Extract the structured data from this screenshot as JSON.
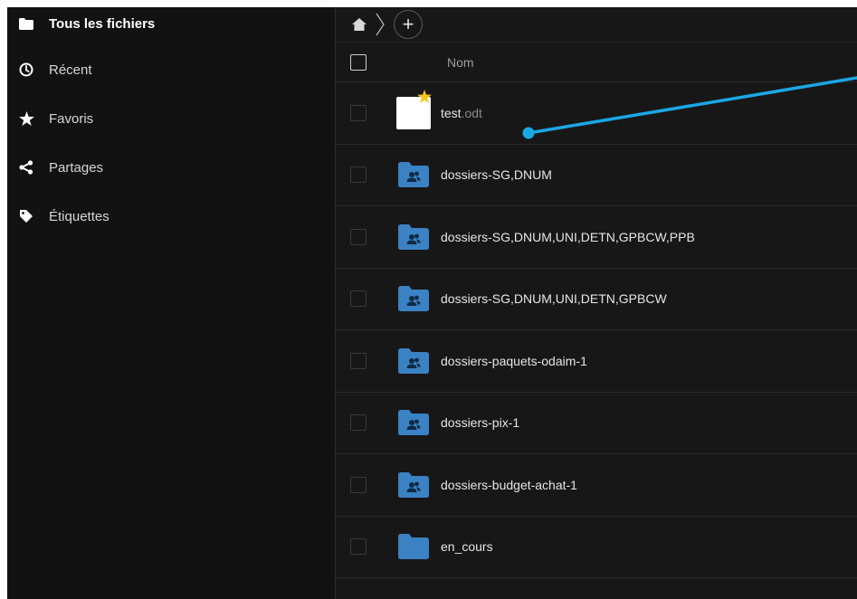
{
  "sidebar": {
    "items": [
      {
        "label": "Tous les fichiers",
        "icon": "folder-icon",
        "active": true
      },
      {
        "label": "Récent",
        "icon": "clock-icon"
      },
      {
        "label": "Favoris",
        "icon": "star-icon"
      },
      {
        "label": "Partages",
        "icon": "share-icon"
      },
      {
        "label": "Étiquettes",
        "icon": "tag-icon"
      }
    ]
  },
  "topbar": {
    "home_icon": "home-icon",
    "add_label": "+"
  },
  "table": {
    "header_name": "Nom",
    "files": [
      {
        "name": "test",
        "ext": ".odt",
        "type": "document",
        "favorite": true
      },
      {
        "name": "dossiers-SG,DNUM",
        "ext": "",
        "type": "shared-folder"
      },
      {
        "name": "dossiers-SG,DNUM,UNI,DETN,GPBCW,PPB",
        "ext": "",
        "type": "shared-folder"
      },
      {
        "name": "dossiers-SG,DNUM,UNI,DETN,GPBCW",
        "ext": "",
        "type": "shared-folder"
      },
      {
        "name": "dossiers-paquets-odaim-1",
        "ext": "",
        "type": "shared-folder"
      },
      {
        "name": "dossiers-pix-1",
        "ext": "",
        "type": "shared-folder"
      },
      {
        "name": "dossiers-budget-achat-1",
        "ext": "",
        "type": "shared-folder"
      },
      {
        "name": "en_cours",
        "ext": "",
        "type": "folder"
      }
    ]
  },
  "colors": {
    "folder_blue": "#3a82c4",
    "annotation": "#1aa7e6",
    "star": "#f5c518"
  }
}
